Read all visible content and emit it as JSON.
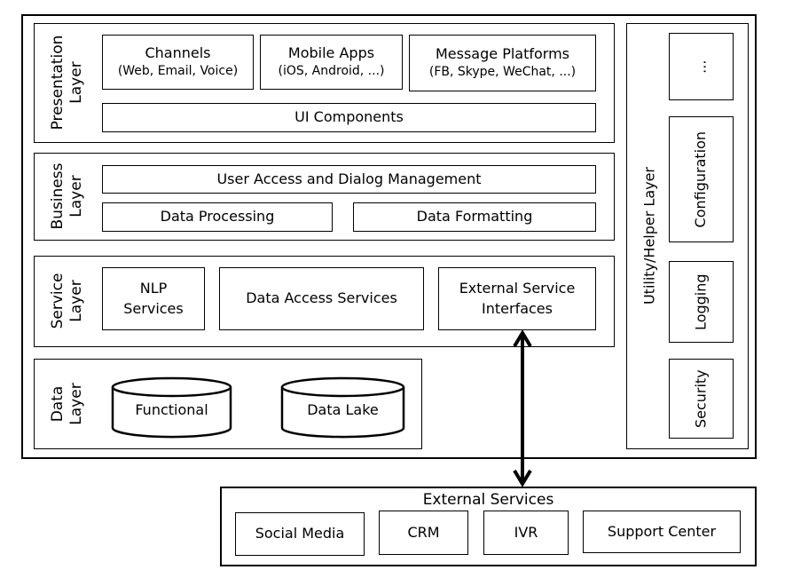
{
  "presentation_layer": {
    "label_line1": "Presentation",
    "label_line2": "Layer",
    "channels": {
      "title": "Channels",
      "detail": "(Web, Email, Voice)"
    },
    "mobile_apps": {
      "title": "Mobile Apps",
      "detail": "(iOS, Android, ...)"
    },
    "message_platforms": {
      "title": "Message Platforms",
      "detail": "(FB, Skype, WeChat, ...)"
    },
    "ui_components": "UI Components"
  },
  "business_layer": {
    "label_line1": "Business",
    "label_line2": "Layer",
    "user_access": "User Access and Dialog Management",
    "data_processing": "Data Processing",
    "data_formatting": "Data Formatting"
  },
  "service_layer": {
    "label_line1": "Service",
    "label_line2": "Layer",
    "nlp_line1": "NLP",
    "nlp_line2": "Services",
    "data_access": "Data Access Services",
    "external_line1": "External Service",
    "external_line2": "Interfaces"
  },
  "data_layer": {
    "label_line1": "Data",
    "label_line2": "Layer",
    "functional": "Functional",
    "data_lake": "Data Lake"
  },
  "utility_layer": {
    "label": "Utility/Helper Layer",
    "more": "...",
    "configuration": "Configuration",
    "logging": "Logging",
    "security": "Security"
  },
  "external_services": {
    "title": "External Services",
    "items": [
      "Social Media",
      "CRM",
      "IVR",
      "Support Center"
    ]
  }
}
